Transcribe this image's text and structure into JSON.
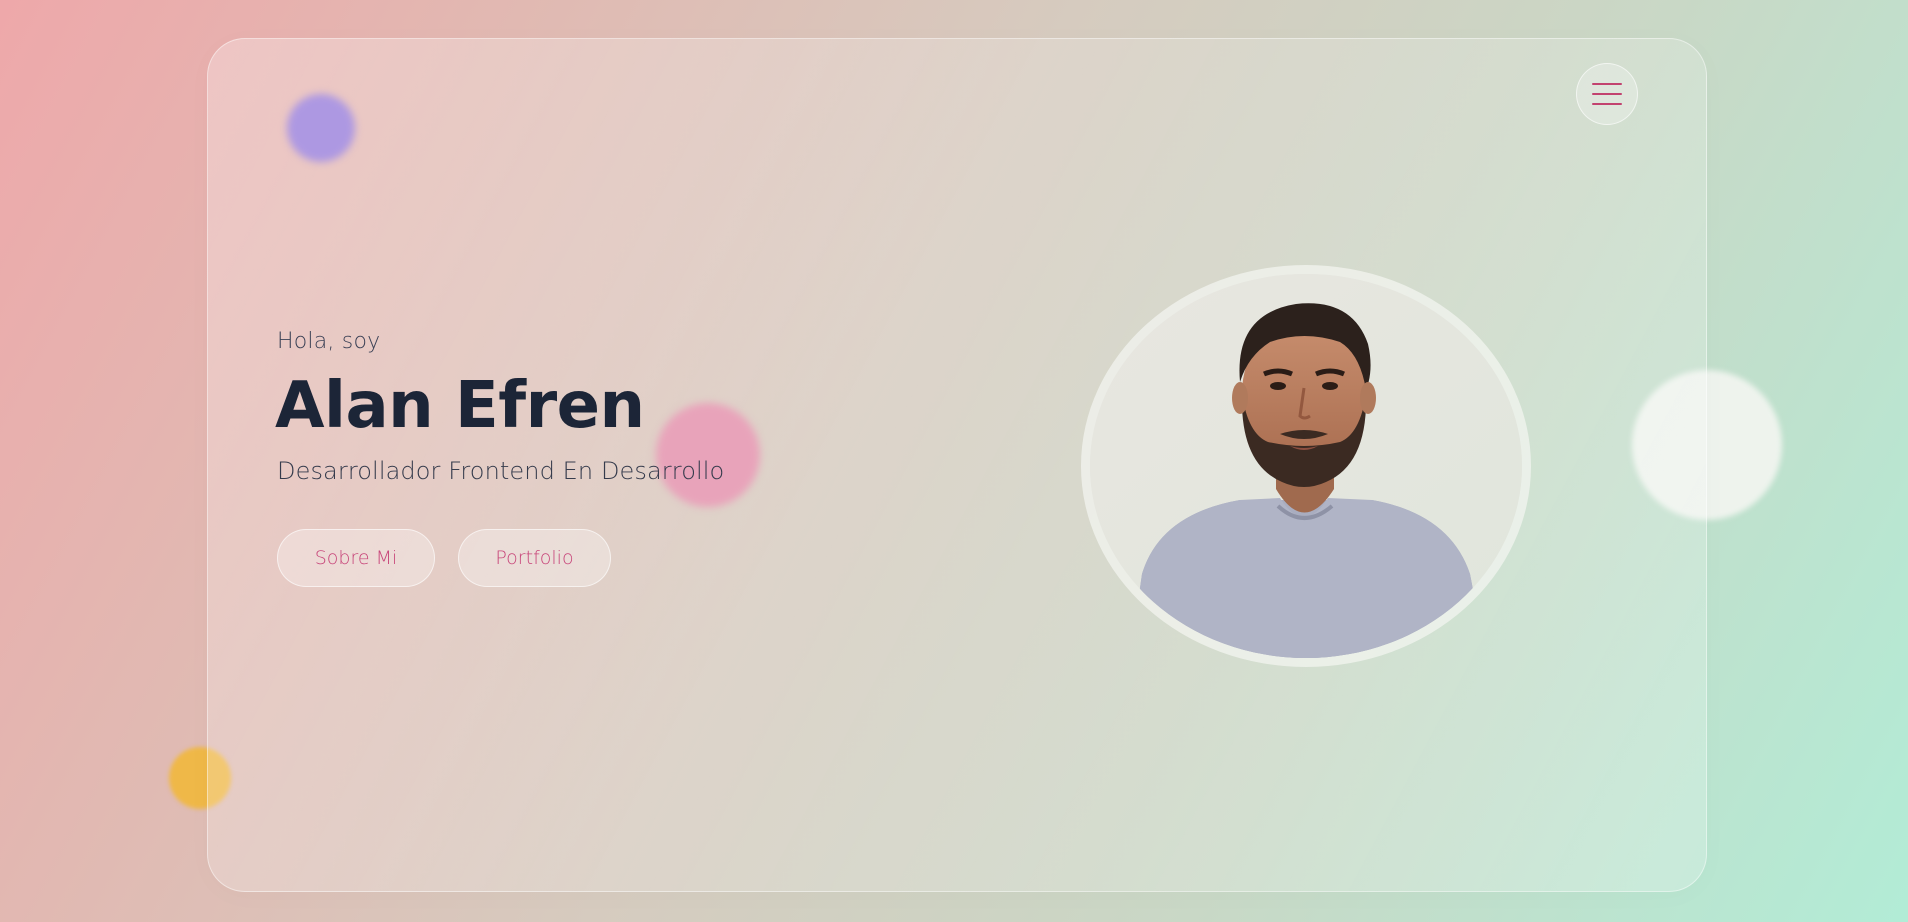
{
  "hero": {
    "greeting": "Hola, soy",
    "name": "Alan Efren",
    "subtitle": "Desarrollador Frontend En Desarrollo"
  },
  "buttons": {
    "about": "Sobre Mi",
    "portfolio": "Portfolio"
  },
  "menu": {
    "icon": "hamburger-menu-icon"
  },
  "colors": {
    "accent": "#c8467a",
    "name_text": "#1c2537",
    "blob_purple": "#ad98e2",
    "blob_pink": "#e8a3ba",
    "blob_yellow": "#efb848"
  }
}
